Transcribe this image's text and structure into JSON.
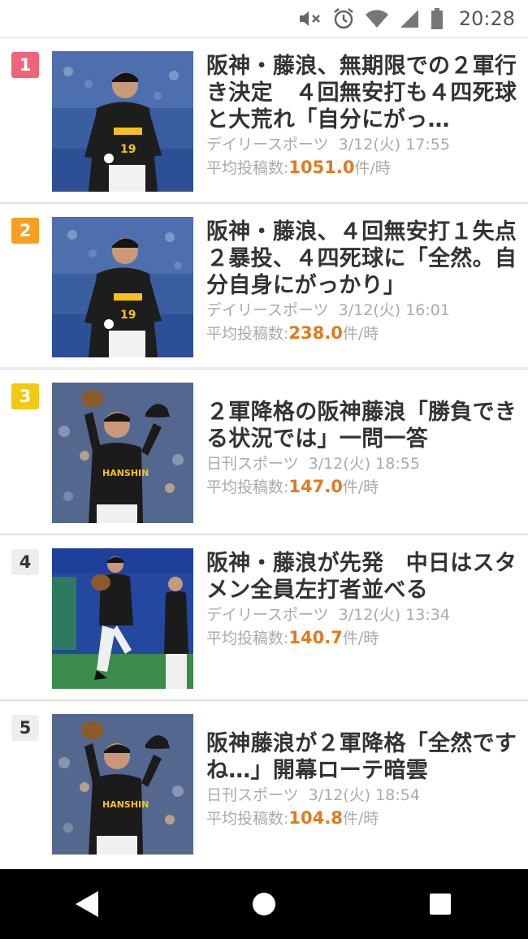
{
  "status_bar": {
    "time": "20:28",
    "icons": [
      "mute-icon",
      "alarm-icon",
      "wifi-icon",
      "signal-icon",
      "battery-icon"
    ]
  },
  "colors": {
    "rank1": "#f0647a",
    "rank2": "#f5a020",
    "rank3": "#f2c811",
    "rate_number": "#e07a20"
  },
  "rate_label": "平均投稿数:",
  "rate_unit": "件/時",
  "articles": [
    {
      "rank": "1",
      "title": "阪神・藤浪、無期限での２軍行き決定　４回無安打も４四死球と大荒れ「自分にがっ…",
      "source": "デイリースポーツ",
      "time": "3/12(火) 17:55",
      "rate": "1051.0",
      "image": "pitcher-looking-up-photo"
    },
    {
      "rank": "2",
      "title": "阪神・藤浪、４回無安打１失点　２暴投、４四死球に「全然。自分自身にがっかり」",
      "source": "デイリースポーツ",
      "time": "3/12(火) 16:01",
      "rate": "238.0",
      "image": "pitcher-looking-up-photo"
    },
    {
      "rank": "3",
      "title": "２軍降格の阪神藤浪「勝負できる状況では」一問一答",
      "source": "日刊スポーツ",
      "time": "3/12(火) 18:55",
      "rate": "147.0",
      "image": "pitcher-cap-off-photo"
    },
    {
      "rank": "4",
      "title": "阪神・藤浪が先発　中日はスタメン全員左打者並べる",
      "source": "デイリースポーツ",
      "time": "3/12(火) 13:34",
      "rate": "140.7",
      "image": "pitcher-windup-photo"
    },
    {
      "rank": "5",
      "title": "阪神藤浪が２軍降格「全然ですね…」開幕ローテ暗雲",
      "source": "日刊スポーツ",
      "time": "3/12(火) 18:54",
      "rate": "104.8",
      "image": "pitcher-cap-off-photo"
    }
  ],
  "nav": [
    "back-icon",
    "home-icon",
    "recents-icon"
  ]
}
